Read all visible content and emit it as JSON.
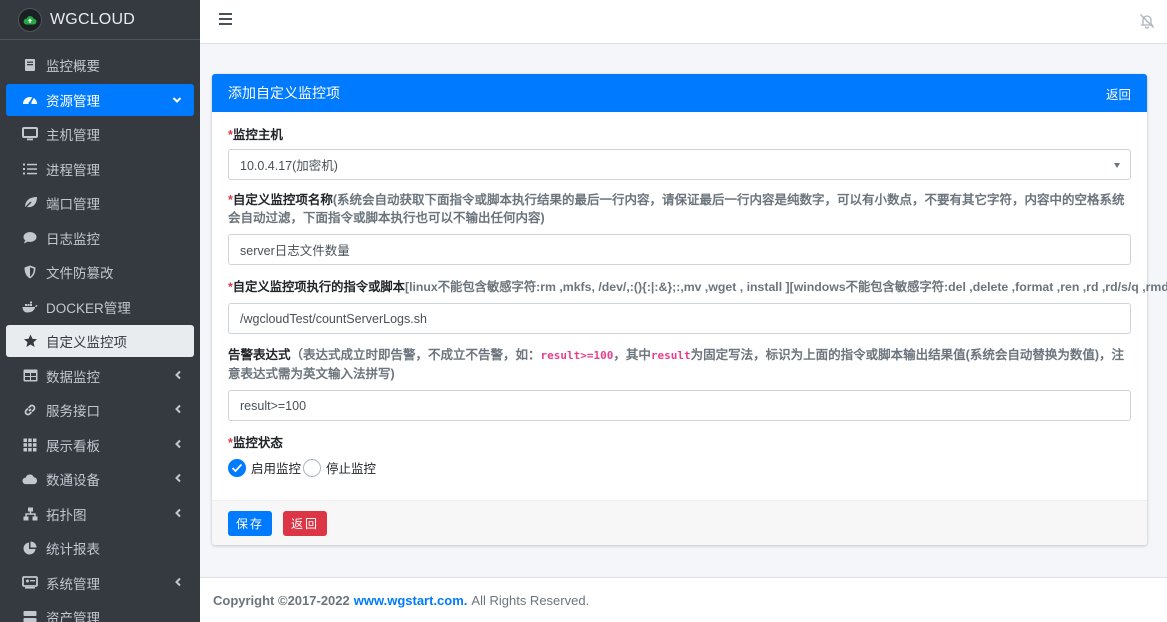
{
  "brand": {
    "name": "WGCLOUD"
  },
  "sidebar": {
    "items": [
      {
        "label": "监控概要",
        "icon": "book-icon"
      },
      {
        "label": "资源管理",
        "icon": "dashboard-icon"
      },
      {
        "label": "主机管理",
        "icon": "desktop-icon"
      },
      {
        "label": "进程管理",
        "icon": "list-icon"
      },
      {
        "label": "端口管理",
        "icon": "leaf-icon"
      },
      {
        "label": "日志监控",
        "icon": "comment-icon"
      },
      {
        "label": "文件防篡改",
        "icon": "shield-icon"
      },
      {
        "label": "DOCKER管理",
        "icon": "docker-icon"
      },
      {
        "label": "自定义监控项",
        "icon": "star-icon"
      },
      {
        "label": "数据监控",
        "icon": "table-icon"
      },
      {
        "label": "服务接口",
        "icon": "link-icon"
      },
      {
        "label": "展示看板",
        "icon": "grid-icon"
      },
      {
        "label": "数通设备",
        "icon": "cloud-icon"
      },
      {
        "label": "拓扑图",
        "icon": "sitemap-icon"
      },
      {
        "label": "统计报表",
        "icon": "pie-icon"
      },
      {
        "label": "系统管理",
        "icon": "id-card-icon"
      },
      {
        "label": "资产管理",
        "icon": "server-icon"
      }
    ]
  },
  "card": {
    "title": "添加自定义监控项",
    "back_link": "返回",
    "host": {
      "required": "*",
      "label": "监控主机",
      "value": "10.0.4.17(加密机)"
    },
    "name": {
      "required": "*",
      "label": "自定义监控项名称",
      "hint": "(系统会自动获取下面指令或脚本执行结果的最后一行内容，请保证最后一行内容是纯数字，可以有小数点，不要有其它字符，内容中的空格系统会自动过滤，下面指令或脚本执行也可以不输出任何内容)",
      "value": "server日志文件数量"
    },
    "command": {
      "required": "*",
      "label": "自定义监控项执行的指令或脚本",
      "hint": "[linux不能包含敏感字符:rm ,mkfs, /dev/,:(){:|:&};:,mv ,wget , install ][windows不能包含敏感字符:del ,delete ,format ,ren ,rd ,rd/s/q ,rmdir ]",
      "value": "/wgcloudTest/countServerLogs.sh"
    },
    "alarm": {
      "label": "告警表达式",
      "hint_a": "（表达式成立时即告警，不成立不告警，如：",
      "hint_code1": "result>=100",
      "hint_b": "，其中",
      "hint_code2": "result",
      "hint_c": "为固定写法，标识为上面的指令或脚本输出结果值(系统会自动替换为数值)，注意表达式需为英文输入法拼写)",
      "value": "result>=100"
    },
    "status": {
      "required": "*",
      "label": "监控状态",
      "option_on": "启用监控",
      "option_off": "停止监控",
      "selected": "启用监控"
    },
    "save_button": "保存",
    "back_button": "返回"
  },
  "footer": {
    "copyright": "Copyright ©2017-2022",
    "link": "www.wgstart.com.",
    "rights": "All Rights Reserved."
  }
}
